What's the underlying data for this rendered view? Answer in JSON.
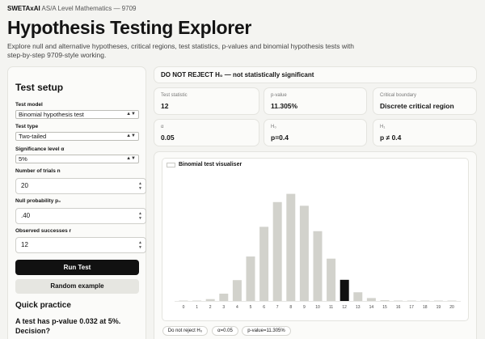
{
  "header": {
    "brand": "SWETAxAI",
    "course": "AS/A Level Mathematics — 9709",
    "title": "Hypothesis Testing Explorer",
    "description": "Explore null and alternative hypotheses, critical regions, test statistics, p-values and binomial hypothesis tests with step-by-step 9709-style working."
  },
  "setup": {
    "title": "Test setup",
    "fields": {
      "test_model": {
        "label": "Test model",
        "value": "Binomial hypothesis test"
      },
      "test_type": {
        "label": "Test type",
        "value": "Two-tailed"
      },
      "significance": {
        "label": "Significance level α",
        "value": "5%"
      },
      "trials": {
        "label": "Number of trials n",
        "value": "20"
      },
      "null_prob": {
        "label": "Null probability p₀",
        "value": ".40"
      },
      "observed": {
        "label": "Observed successes r",
        "value": "12"
      }
    },
    "run_label": "Run Test",
    "random_label": "Random example"
  },
  "quick_practice": {
    "title": "Quick practice",
    "question": "A test has p-value 0.032 at 5%. Decision?"
  },
  "result": {
    "banner": "DO NOT REJECT H₀ — not statistically significant",
    "stats": [
      {
        "label": "Test statistic",
        "value": "12"
      },
      {
        "label": "p-value",
        "value": "11.305%"
      },
      {
        "label": "Critical boundary",
        "value": "Discrete critical region"
      },
      {
        "label": "α",
        "value": "0.05"
      },
      {
        "label": "H₀",
        "value": "p=0.4"
      },
      {
        "label": "H₁",
        "value": "p ≠ 0.4"
      }
    ]
  },
  "visualiser": {
    "title": "Binomial test visualiser",
    "chips": [
      "Do not reject H₀",
      "α=0.05",
      "p-value=11.305%"
    ]
  },
  "chart_data": {
    "type": "bar",
    "categories": [
      "0",
      "1",
      "2",
      "3",
      "4",
      "5",
      "6",
      "7",
      "8",
      "9",
      "10",
      "11",
      "12",
      "13",
      "14",
      "15",
      "16",
      "17",
      "18",
      "19",
      "20"
    ],
    "values": [
      4e-05,
      0.0005,
      0.0031,
      0.0123,
      0.035,
      0.0746,
      0.1244,
      0.1659,
      0.1797,
      0.1597,
      0.1171,
      0.071,
      0.0355,
      0.0146,
      0.0049,
      0.0013,
      0.0003,
      4e-05,
      0,
      0,
      0
    ],
    "highlight_category": "12",
    "ylim": [
      0,
      0.19
    ],
    "colors": {
      "bar": "#d2d2cc",
      "observed": "#111111",
      "axis": "#cfcfca"
    },
    "grid": false
  }
}
